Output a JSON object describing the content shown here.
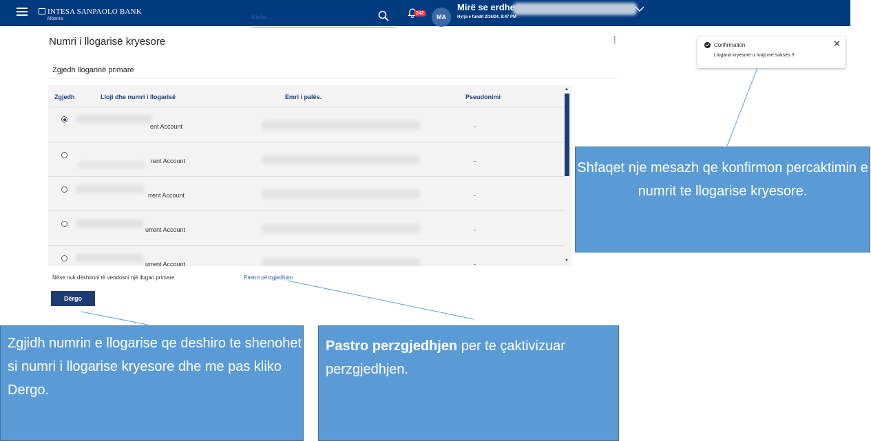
{
  "header": {
    "bank_name": "INTESA SANPAOLO BANK",
    "bank_country": "Albania",
    "search_placeholder": "Kërko...",
    "notification_count": "242",
    "avatar_initials": "MA",
    "welcome": "Mirë se erdhe",
    "last_login": "Hyrja e fundit 2/16/24, 8:47 PM",
    "brand_color": "#003b80"
  },
  "main": {
    "page_title": "Numri i llogarisë kryesore",
    "section_title": "Zgjedh llogarinë primare",
    "table": {
      "headers": [
        "Zgjedh",
        "Lloji dhe numri i llogarisë",
        "Emri i palës.",
        "Pseudonimi"
      ],
      "rows": [
        {
          "selected": true,
          "account": "ent Account",
          "alias": "-"
        },
        {
          "selected": false,
          "account": "rent Account",
          "alias": "-"
        },
        {
          "selected": false,
          "account": "rrent Account",
          "alias": "-"
        },
        {
          "selected": false,
          "account": "urrent Account",
          "alias": "-"
        },
        {
          "selected": false,
          "account": "urrent Account",
          "alias": "-"
        }
      ]
    },
    "footer_note": "Nëse nuk dëshironi të vendosni një llogari primare",
    "clear_link": "Pastro përzgjedhjen",
    "send_button": "Dërgo"
  },
  "toast": {
    "title": "Confirmation",
    "message": "Llogaria kryesore u ruajt me sukses !!",
    "close": "✕"
  },
  "callouts": {
    "confirmation": "Shfaqet nje mesazh qe konfirmon percaktimin e numrit te llogarise kryesore.",
    "select": "Zgjidh numrin e llogarise qe deshiro te shenohet si numri i llogarise kryesore dhe me pas kliko Dergo.",
    "clear_bold": "Pastro perzgjedhjen",
    "clear_rest": " per te çaktivizuar perzgjedhjen."
  }
}
